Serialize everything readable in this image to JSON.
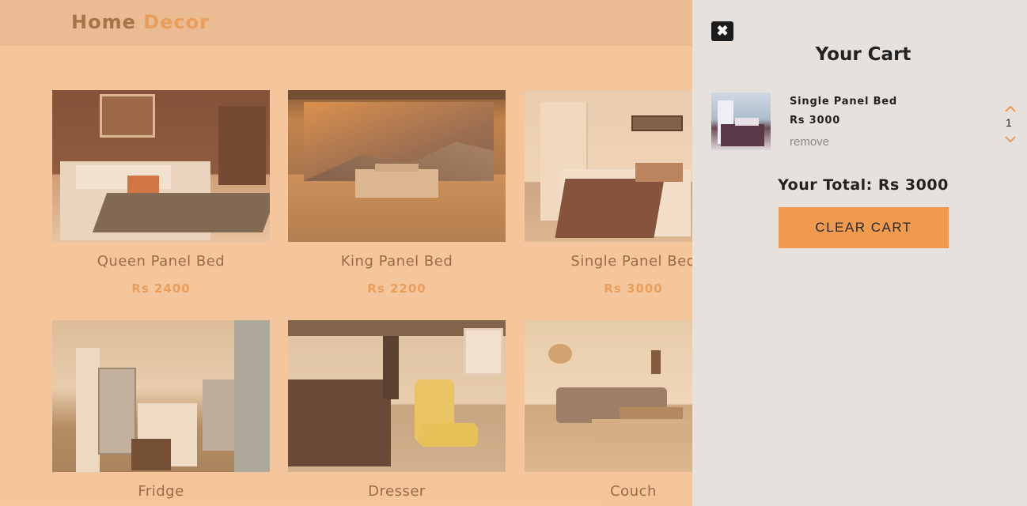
{
  "brand": {
    "word1": "Home",
    "word2": "Decor"
  },
  "products": [
    {
      "title": "Queen Panel Bed",
      "price": "Rs 2400"
    },
    {
      "title": "King Panel Bed",
      "price": "Rs 2200"
    },
    {
      "title": "Single Panel Bed",
      "price": "Rs 3000"
    },
    {
      "title": "Fridge",
      "price": ""
    },
    {
      "title": "Dresser",
      "price": ""
    },
    {
      "title": "Couch",
      "price": ""
    }
  ],
  "cart": {
    "close_icon": "close-icon",
    "title": "Your Cart",
    "items": [
      {
        "name": "Single Panel Bed",
        "price": "Rs 3000",
        "remove_label": "remove",
        "quantity": "1"
      }
    ],
    "total": "Your Total: Rs 3000",
    "clear_label": "CLEAR CART"
  },
  "colors": {
    "page_bg": "#f6cba4",
    "navbar_bg": "#e9be99",
    "accent": "#e89a55",
    "brand_dark": "#97673f",
    "cart_bg": "#e7e1de",
    "clear_button": "#ef9a4f"
  }
}
